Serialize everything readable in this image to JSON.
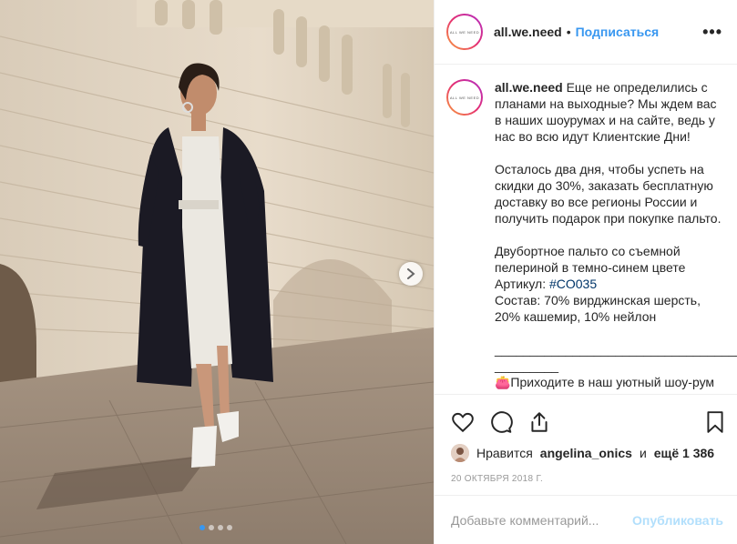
{
  "post": {
    "username": "all.we.need",
    "bullet": "•",
    "follow_label": "Подписаться",
    "more_label": "•••",
    "avatar_label": "ALL WE NEED"
  },
  "caption": {
    "username": "all.we.need",
    "line1": "Еще не определились с планами на выходные? Мы ждем вас в наших шоурумах и на сайте, ведь у нас во всю идут Клиентские Дни!",
    "line2": "Осталось два дня, чтобы успеть на скидки до 30%, заказать бесплатную доставку во все регионы России и получить подарок при покупке пальто.",
    "line3": "Двубортное пальто со съемной пелериной в темно-синем цвете",
    "article_label": "Артикул: ",
    "article_tag": "#CO035",
    "composition": "Состав: 70% вирджинская шерсть, 20% кашемир, 10% нейлон",
    "divider": "____________________________________",
    "divider2": "_________",
    "line4": "👛Приходите в наш уютный шоу-рум"
  },
  "likes": {
    "prefix": "Нравится",
    "user": "angelina_onics",
    "and": "и",
    "more": "ещё 1 386"
  },
  "date": "20 ОКТЯБРЯ 2018 Г.",
  "comment": {
    "placeholder": "Добавьте комментарий...",
    "publish_label": "Опубликовать"
  },
  "carousel": {
    "total": 4,
    "active_index": 0
  },
  "colors": {
    "link": "#3897f0",
    "hashtag": "#003569",
    "publish_disabled": "#b2dffc"
  }
}
